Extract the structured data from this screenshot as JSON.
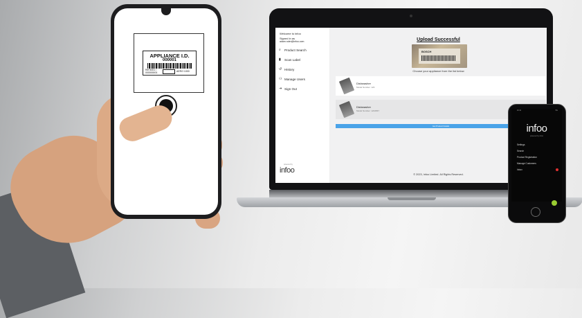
{
  "scan_phone": {
    "label_title": "APPLIANCE I.D.",
    "label_code": "000001",
    "label_left_text": "Ref 5001 / 000000001",
    "label_right_text": "AERO 1000"
  },
  "web_app": {
    "sidebar": {
      "welcome": "Welcome to infoo",
      "signed_in_as": "Signed in as",
      "email": "adam.ruler@infoo.com",
      "nav": [
        {
          "label": "Product Search",
          "icon": "search-icon"
        },
        {
          "label": "Scan Label",
          "icon": "phone-icon"
        },
        {
          "label": "History",
          "icon": "history-icon"
        },
        {
          "label": "Manage Users",
          "icon": "users-icon"
        },
        {
          "label": "Sign Out",
          "icon": "signout-icon"
        }
      ],
      "brand": "infoo",
      "brand_small": "powered by"
    },
    "main": {
      "title": "Upload Successful",
      "photo_brand": "BOSCH",
      "instruction": "Choose your appliance from the list below",
      "results": [
        {
          "name": "Dishwasher",
          "model": "Model Number: 123"
        },
        {
          "name": "Dishwasher",
          "model": "Model Number: 1234567"
        }
      ],
      "button": "Get Product Details",
      "footer": "© 2023, Infoo Limited. All Rights Reserved."
    }
  },
  "mobile_app": {
    "status_time": "10:11",
    "status_right": "5G",
    "logo": "infoo",
    "subtitle": "powered by infoo",
    "menu": [
      "Settings",
      "Search",
      "Product Registration",
      "Manage Customers",
      "Inbox"
    ]
  },
  "colors": {
    "accent_blue": "#4aa3e8",
    "badge_red": "#e03131",
    "fab_green": "#9acd32"
  }
}
